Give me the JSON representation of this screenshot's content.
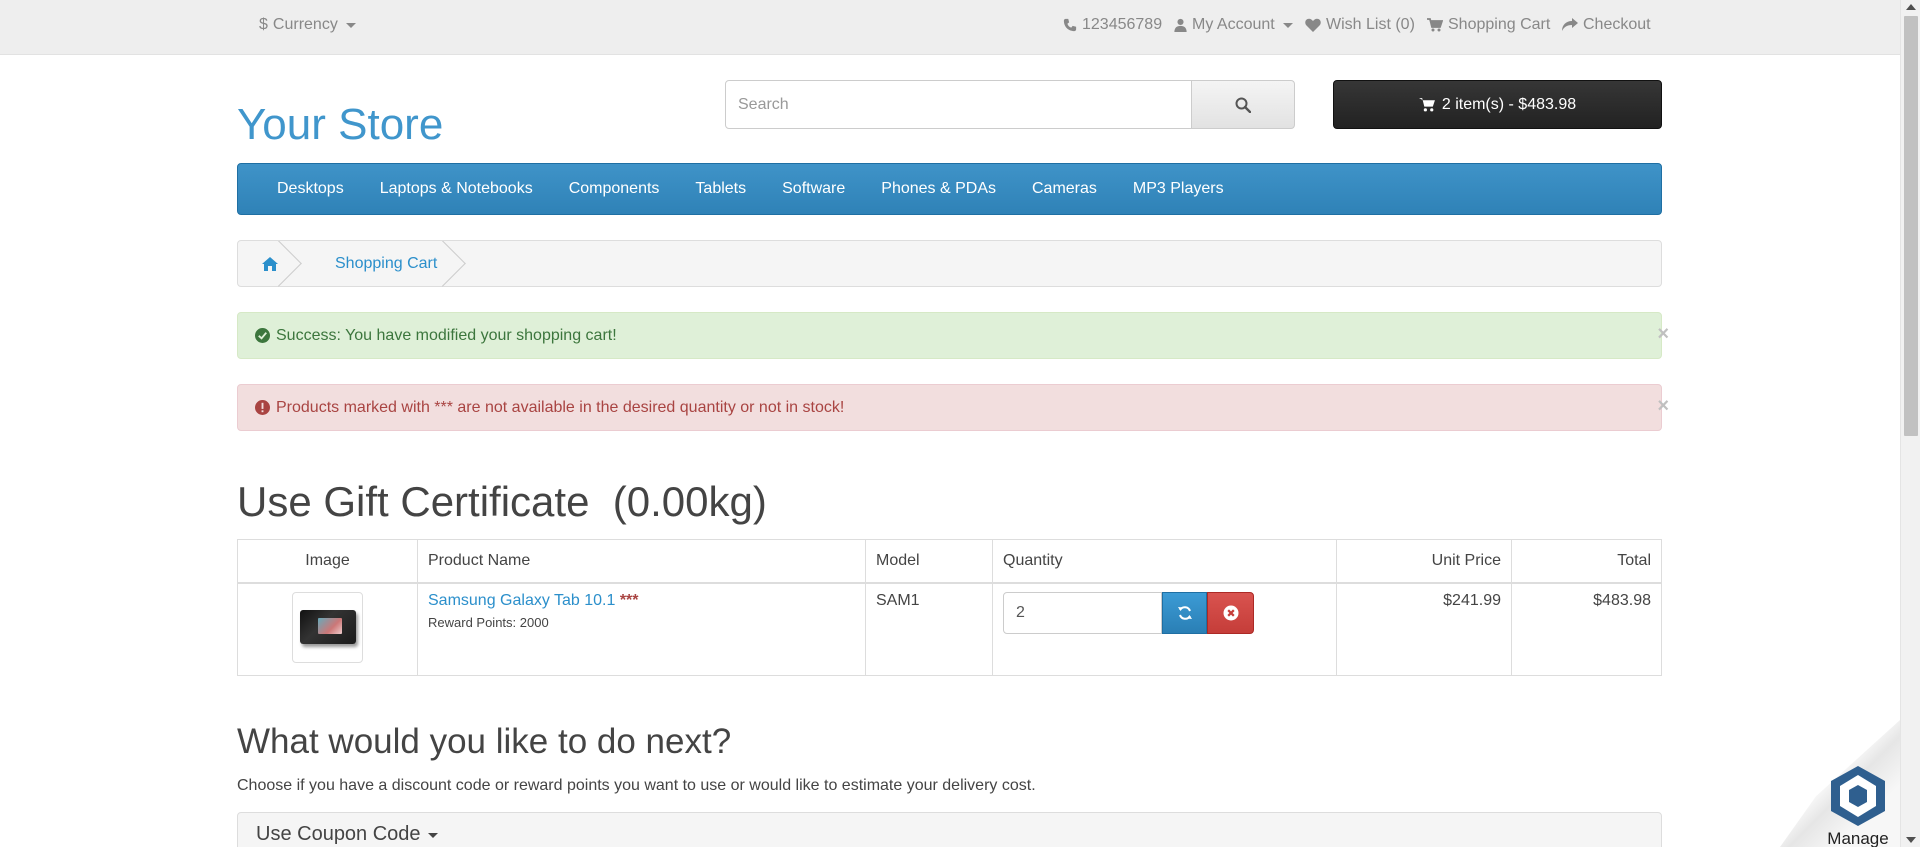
{
  "topbar": {
    "currency_label": "Currency",
    "currency_symbol": "$",
    "phone": "123456789",
    "my_account": "My Account",
    "wish_list": "Wish List (0)",
    "shopping_cart": "Shopping Cart",
    "checkout": "Checkout"
  },
  "header": {
    "logo": "Your Store",
    "search_placeholder": "Search",
    "cart_summary": "2 item(s) - $483.98"
  },
  "nav": {
    "items": [
      "Desktops",
      "Laptops & Notebooks",
      "Components",
      "Tablets",
      "Software",
      "Phones & PDAs",
      "Cameras",
      "MP3 Players"
    ]
  },
  "breadcrumb": {
    "items": [
      "Shopping Cart"
    ]
  },
  "alerts": {
    "success": "Success: You have modified your shopping cart!",
    "danger": "Products marked with *** are not available in the desired quantity or not in stock!",
    "close": "×"
  },
  "page_title": "Use Gift Certificate  (0.00kg)",
  "table": {
    "headers": [
      "Image",
      "Product Name",
      "Model",
      "Quantity",
      "Unit Price",
      "Total"
    ],
    "rows": [
      {
        "product_name": "Samsung Galaxy Tab 10.1",
        "stock_flag": "***",
        "reward_points": "Reward Points: 2000",
        "model": "SAM1",
        "quantity": "2",
        "unit_price": "$241.99",
        "total": "$483.98"
      }
    ]
  },
  "next_section": {
    "title": "What would you like to do next?",
    "description": "Choose if you have a discount code or reward points you want to use or would like to estimate your delivery cost.",
    "coupon_panel": "Use Coupon Code"
  },
  "manage_badge": "Manage",
  "colors": {
    "brand_blue": "#2b8fcb",
    "nav_blue": "#3f93c8",
    "success_bg": "#dff0d8",
    "danger_bg": "#f2dede",
    "danger_btn": "#d9534f"
  }
}
